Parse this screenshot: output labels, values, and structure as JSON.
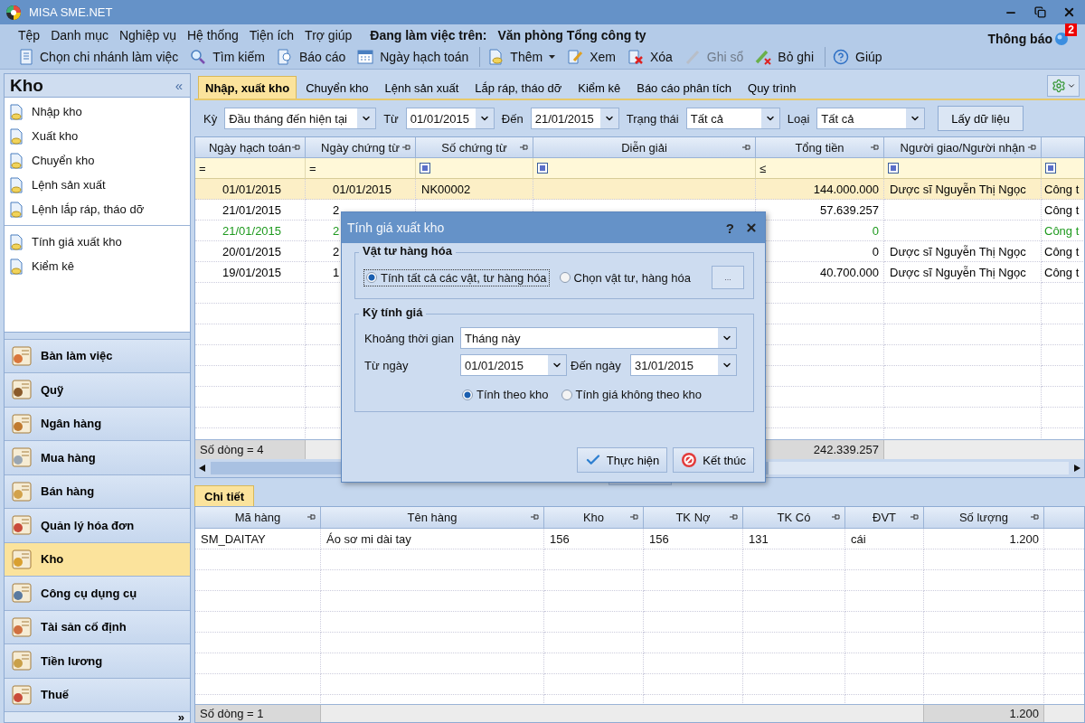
{
  "window": {
    "title": "MISA SME.NET"
  },
  "menu": [
    "Tệp",
    "Danh mục",
    "Nghiệp vụ",
    "Hệ thống",
    "Tiện ích",
    "Trợ giúp"
  ],
  "workplace": {
    "label": "Đang làm việc trên:",
    "value": "Văn phòng Tổng công ty"
  },
  "notifications": {
    "label": "Thông báo",
    "count": "2"
  },
  "toolbar": [
    {
      "label": "Chọn chi nhánh làm việc",
      "disabled": false,
      "has_menu": false,
      "separator_before": false
    },
    {
      "label": "Tìm kiếm",
      "disabled": false,
      "has_menu": false,
      "separator_before": false
    },
    {
      "label": "Báo cáo",
      "disabled": false,
      "has_menu": false,
      "separator_before": false
    },
    {
      "label": "Ngày hạch toán",
      "disabled": false,
      "has_menu": false,
      "separator_before": false
    },
    {
      "label": "Thêm",
      "disabled": false,
      "has_menu": true,
      "separator_before": true
    },
    {
      "label": "Xem",
      "disabled": false,
      "has_menu": false,
      "separator_before": false
    },
    {
      "label": "Xóa",
      "disabled": false,
      "has_menu": false,
      "separator_before": false
    },
    {
      "label": "Ghi sổ",
      "disabled": true,
      "has_menu": false,
      "separator_before": false
    },
    {
      "label": "Bỏ ghi",
      "disabled": false,
      "has_menu": false,
      "separator_before": false
    },
    {
      "label": "Giúp",
      "disabled": false,
      "has_menu": false,
      "separator_before": true
    }
  ],
  "sidebar": {
    "title": "Kho",
    "collapse": "«",
    "groups": [
      [
        "Nhập kho",
        "Xuất kho",
        "Chuyển kho",
        "Lệnh sản xuất",
        "Lệnh lắp ráp, tháo dỡ"
      ],
      [
        "Tính giá xuất kho",
        "Kiểm kê"
      ]
    ],
    "modules": [
      {
        "label": "Bàn làm việc",
        "selected": false
      },
      {
        "label": "Quỹ",
        "selected": false
      },
      {
        "label": "Ngân hàng",
        "selected": false
      },
      {
        "label": "Mua hàng",
        "selected": false
      },
      {
        "label": "Bán hàng",
        "selected": false
      },
      {
        "label": "Quản lý hóa đơn",
        "selected": false
      },
      {
        "label": "Kho",
        "selected": true
      },
      {
        "label": "Công cụ dụng cụ",
        "selected": false
      },
      {
        "label": "Tài sản cố định",
        "selected": false
      },
      {
        "label": "Tiền lương",
        "selected": false
      },
      {
        "label": "Thuế",
        "selected": false
      }
    ],
    "more": "»"
  },
  "tabs": [
    {
      "label": "Nhập, xuất kho",
      "selected": true
    },
    {
      "label": "Chuyển kho",
      "selected": false
    },
    {
      "label": "Lệnh sản xuất",
      "selected": false
    },
    {
      "label": "Lắp ráp, tháo dỡ",
      "selected": false
    },
    {
      "label": "Kiểm kê",
      "selected": false
    },
    {
      "label": "Báo cáo phân tích",
      "selected": false
    },
    {
      "label": "Quy trình",
      "selected": false
    }
  ],
  "filters": [
    {
      "label": "Kỳ",
      "value": "Đầu tháng đến hiện tại"
    },
    {
      "label": "Từ",
      "value": "01/01/2015"
    },
    {
      "label": "Đến",
      "value": "21/01/2015"
    },
    {
      "label": "Trạng thái",
      "value": "Tất cả"
    },
    {
      "label": "Loại",
      "value": "Tất cả"
    }
  ],
  "fetch_button": "Lấy dữ liệu",
  "grid": {
    "columns": [
      "Ngày hạch toán",
      "Ngày chứng từ",
      "Số chứng từ",
      "Diễn giải",
      "Tổng tiền",
      "Người giao/Người nhận"
    ],
    "filter_row": [
      {
        "kind": "op",
        "text": "="
      },
      {
        "kind": "op",
        "text": "="
      },
      {
        "kind": "box"
      },
      {
        "kind": "box"
      },
      {
        "kind": "op",
        "text": "≤"
      },
      {
        "kind": "box"
      },
      {
        "kind": "box"
      }
    ],
    "rows": [
      {
        "selected": true,
        "color": "#000000",
        "cells": [
          "01/01/2015",
          "01/01/2015",
          "NK00002",
          "",
          "144.000.000",
          "Dược sĩ Nguyễn Thị Ngọc",
          "Công t"
        ]
      },
      {
        "selected": false,
        "color": "#000000",
        "cells": [
          "21/01/2015",
          "2",
          "",
          "",
          "57.639.257",
          "",
          "Công t"
        ]
      },
      {
        "selected": false,
        "color": "#1e9a1e",
        "cells": [
          "21/01/2015",
          "2",
          "",
          "",
          "0",
          "",
          "Công t"
        ]
      },
      {
        "selected": false,
        "color": "#000000",
        "cells": [
          "20/01/2015",
          "2",
          "",
          "",
          "0",
          "Dược sĩ Nguyễn Thị Ngọc",
          "Công t"
        ]
      },
      {
        "selected": false,
        "color": "#000000",
        "cells": [
          "19/01/2015",
          "1",
          "",
          "",
          "40.700.000",
          "Dược sĩ Nguyễn Thị Ngọc",
          "Công t"
        ]
      }
    ],
    "footer": {
      "count": "Số dòng = 4",
      "total": "242.339.257"
    }
  },
  "dialog": {
    "title": "Tính giá xuất kho",
    "help": "?",
    "goods": {
      "title": "Vật tư hàng hóa",
      "options": [
        {
          "label": "Tính tất cả các vật, tư hàng hóa",
          "selected": true
        },
        {
          "label": "Chọn vật tư, hàng hóa",
          "selected": false
        }
      ],
      "browse": "..."
    },
    "period": {
      "title": "Kỳ tính giá",
      "range_label": "Khoảng thời gian",
      "range": "Tháng này",
      "from_label": "Từ ngày",
      "from": "01/01/2015",
      "to_label": "Đến ngày",
      "to": "31/01/2015",
      "options": [
        {
          "label": "Tính theo kho",
          "selected": true
        },
        {
          "label": "Tính giá không theo kho",
          "selected": false
        }
      ]
    },
    "buttons": [
      "Thực hiện",
      "Kết thúc"
    ]
  },
  "detail": {
    "tab": "Chi tiết",
    "columns": [
      "Mã hàng",
      "Tên hàng",
      "Kho",
      "TK Nợ",
      "TK Có",
      "ĐVT",
      "Số lượng"
    ],
    "rows": [
      [
        "SM_DAITAY",
        "Áo sơ mi dài tay",
        "156",
        "156",
        "131",
        "cái",
        "1.200"
      ]
    ],
    "footer": {
      "count": "Số dòng = 1",
      "total": "1.200"
    }
  }
}
